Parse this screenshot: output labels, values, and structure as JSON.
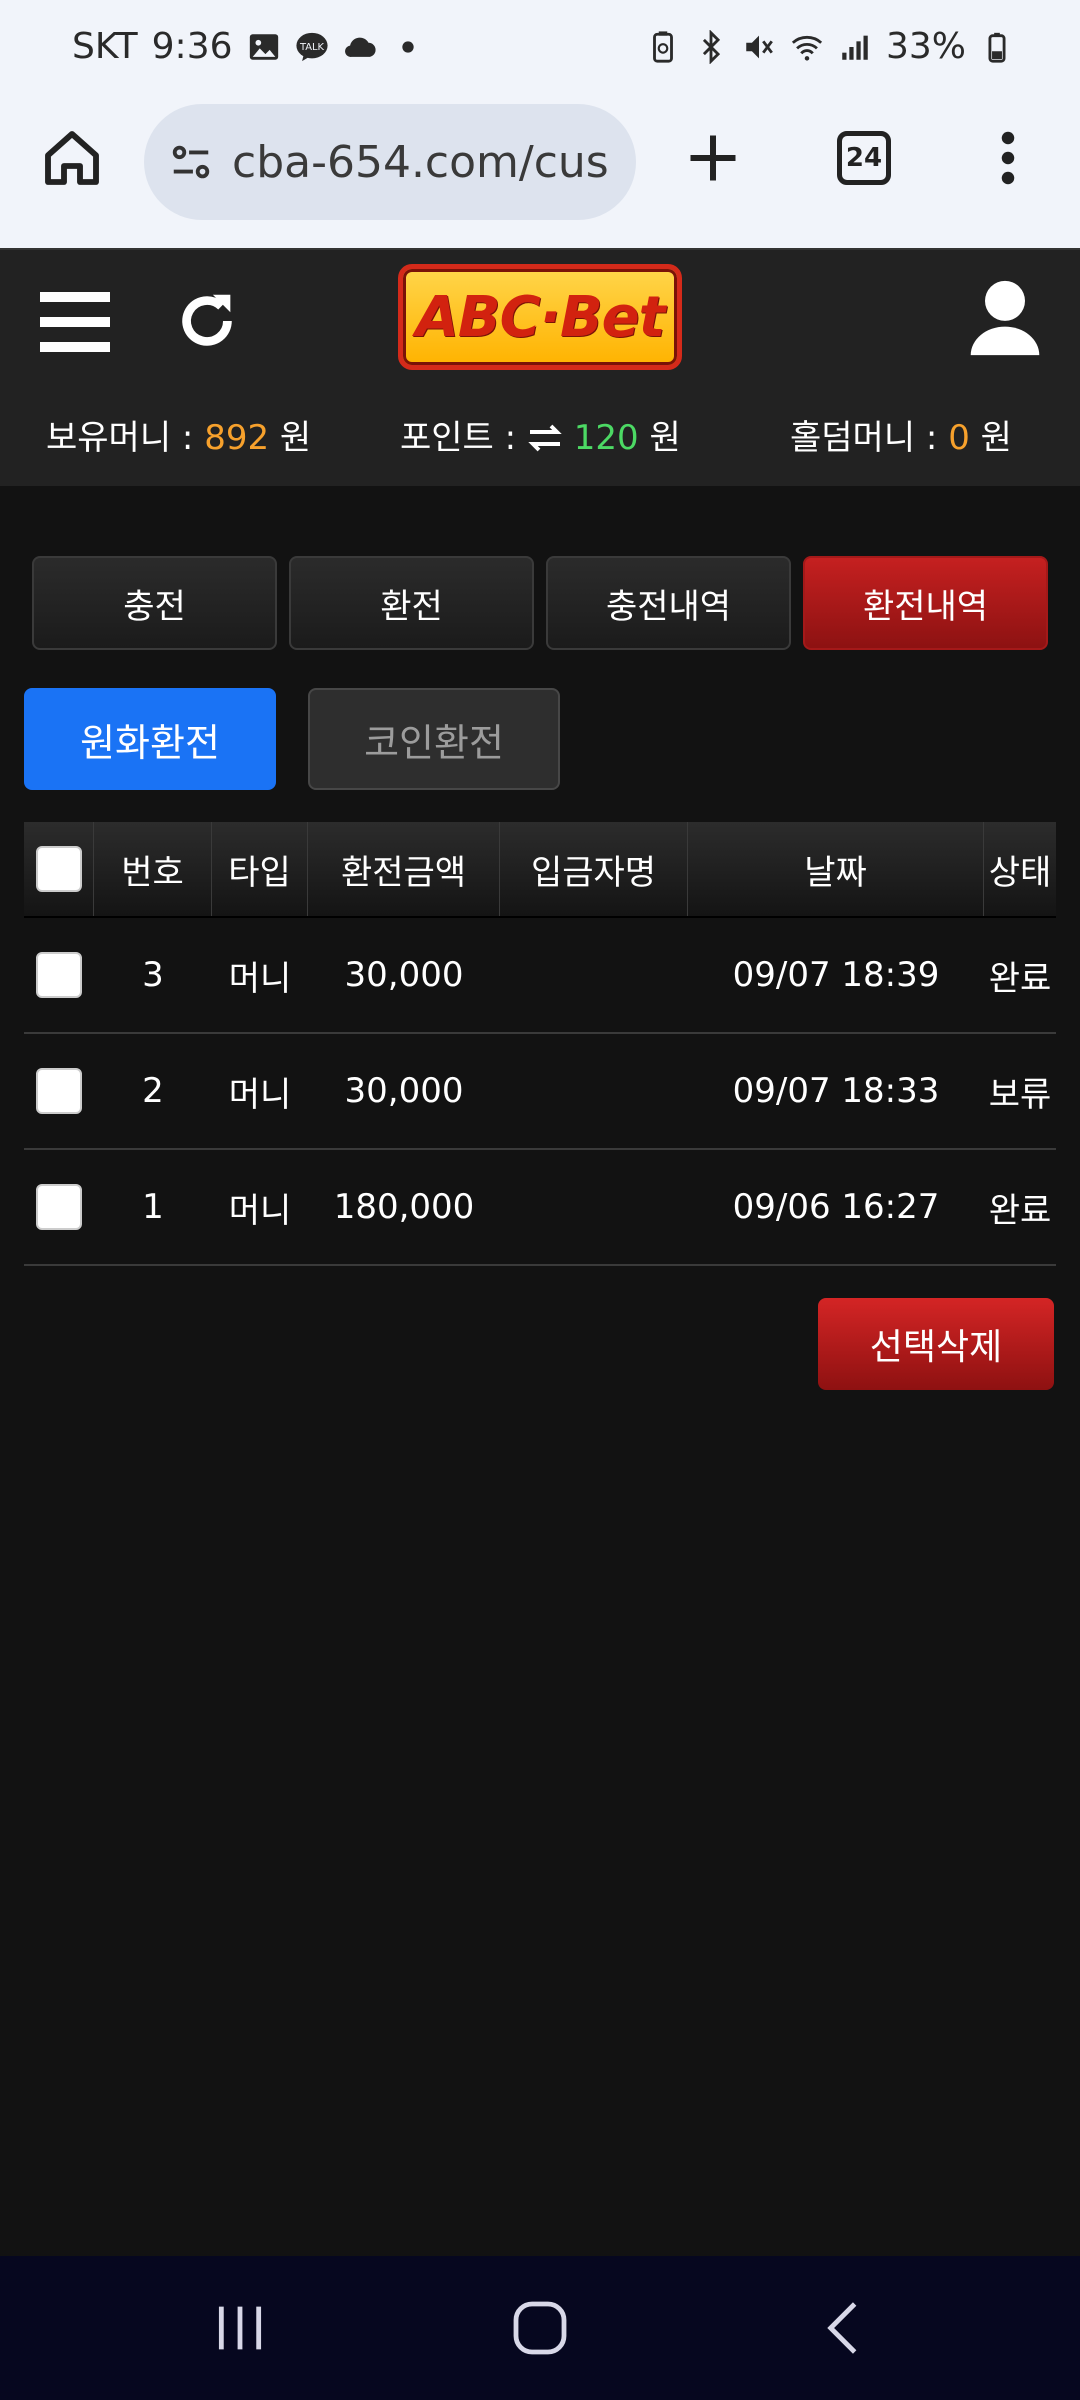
{
  "status_bar": {
    "carrier": "SKT",
    "time": "9:36",
    "battery": "33%",
    "icons": [
      "gallery-icon",
      "kakaotalk-icon",
      "cloud-icon",
      "dot-icon",
      "battery-saver-icon",
      "bluetooth-icon",
      "mute-icon",
      "wifi-icon",
      "signal-icon",
      "battery-icon"
    ],
    "talk_label": "TALK"
  },
  "browser": {
    "url": "cba-654.com/cus",
    "tab_count": "24"
  },
  "site": {
    "logo_text": "ABC·Bet",
    "balance_money_label": "보유머니 : ",
    "balance_money_value": "892",
    "currency": " 원",
    "point_label": "포인트 : ",
    "point_value": "120",
    "hold_money_label": "홀덤머니 : ",
    "hold_money_value": "0",
    "colors": {
      "accent_red": "#c52020",
      "accent_blue": "#1a73f5",
      "money_orange": "#f7a12c",
      "point_green": "#4cd964"
    }
  },
  "tabs": {
    "main": [
      "충전",
      "환전",
      "충전내역",
      "환전내역"
    ],
    "active_main": "환전내역",
    "sub": [
      "원화환전",
      "코인환전"
    ],
    "active_sub": "원화환전"
  },
  "table": {
    "headers": [
      "번호",
      "타입",
      "환전금액",
      "입금자명",
      "날짜",
      "상태"
    ],
    "rows": [
      {
        "no": "3",
        "type": "머니",
        "amount": "30,000",
        "depositor": "",
        "date": "09/07 18:39",
        "status": "완료"
      },
      {
        "no": "2",
        "type": "머니",
        "amount": "30,000",
        "depositor": "",
        "date": "09/07 18:33",
        "status": "보류"
      },
      {
        "no": "1",
        "type": "머니",
        "amount": "180,000",
        "depositor": "",
        "date": "09/06 16:27",
        "status": "완료"
      }
    ]
  },
  "actions": {
    "delete_selected": "선택삭제"
  }
}
